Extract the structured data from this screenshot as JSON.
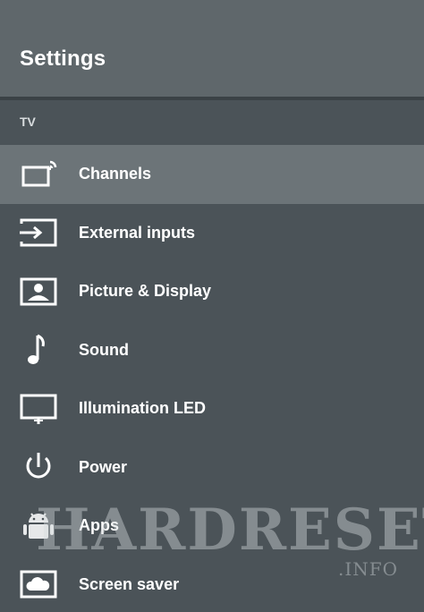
{
  "header": {
    "title": "Settings"
  },
  "section": {
    "label": "TV"
  },
  "menu": {
    "items": [
      {
        "label": "Channels",
        "icon": "channels-icon",
        "selected": true
      },
      {
        "label": "External inputs",
        "icon": "external-inputs-icon",
        "selected": false
      },
      {
        "label": "Picture & Display",
        "icon": "picture-display-icon",
        "selected": false
      },
      {
        "label": "Sound",
        "icon": "music-note-icon",
        "selected": false
      },
      {
        "label": "Illumination LED",
        "icon": "illumination-led-icon",
        "selected": false
      },
      {
        "label": "Power",
        "icon": "power-icon",
        "selected": false
      },
      {
        "label": "Apps",
        "icon": "android-icon",
        "selected": false
      },
      {
        "label": "Screen saver",
        "icon": "screen-saver-icon",
        "selected": false
      }
    ]
  },
  "watermark": {
    "brand": "HARDRESET",
    "suffix": ".INFO"
  },
  "colors": {
    "background": "#4b5358",
    "header": "#5f676b",
    "selected_row": "#6c7478",
    "text": "#ffffff"
  }
}
